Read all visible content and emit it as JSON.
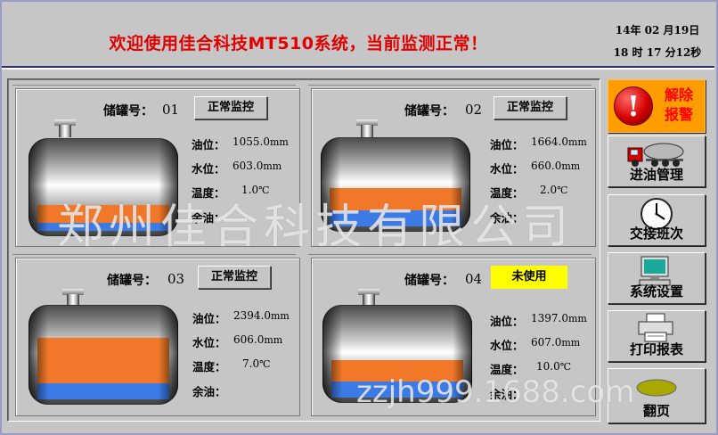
{
  "header": {
    "title": "欢迎使用佳合科技MT510系统，当前监测正常！",
    "date": "14年 02 月19日",
    "time": "18 时 17 分12秒"
  },
  "tank_number_label": "储罐号：",
  "tanks": [
    {
      "number": "01",
      "status": "正常监控",
      "status_color": "#c6c6c6",
      "oil_label": "油位：",
      "oil_value": "1055.0",
      "oil_unit": "mm",
      "water_label": "水位：",
      "water_value": "603.0",
      "water_unit": "mm",
      "temp_label": "温度：",
      "temp_value": "1.0",
      "temp_unit": "℃",
      "remain_label": "余油：",
      "remain_value": "",
      "oil_level_percent": 26,
      "water_level_percent": 8
    },
    {
      "number": "02",
      "status": "正常监控",
      "status_color": "#c6c6c6",
      "oil_label": "油位：",
      "oil_value": "1664.0",
      "oil_unit": "mm",
      "water_label": "水位：",
      "water_value": "660.0",
      "water_unit": "mm",
      "temp_label": "温度：",
      "temp_value": "2.0",
      "temp_unit": "℃",
      "remain_label": "余油：",
      "remain_value": "",
      "oil_level_percent": 41,
      "water_level_percent": 17
    },
    {
      "number": "03",
      "status": "正常监控",
      "status_color": "#c6c6c6",
      "oil_label": "油位：",
      "oil_value": "2394.0",
      "oil_unit": "mm",
      "water_label": "水位：",
      "water_value": "606.0",
      "water_unit": "mm",
      "temp_label": "温度：",
      "temp_value": "7.0",
      "temp_unit": "℃",
      "remain_label": "余油：",
      "remain_value": "",
      "oil_level_percent": 62,
      "water_level_percent": 16
    },
    {
      "number": "04",
      "status": "未使用",
      "status_color": "#ffff00",
      "oil_label": "油位：",
      "oil_value": "1397.0",
      "oil_unit": "mm",
      "water_label": "水位：",
      "water_value": "607.0",
      "water_unit": "mm",
      "temp_label": "温度：",
      "temp_value": "10.0",
      "temp_unit": "℃",
      "remain_label": "余油：",
      "remain_value": "",
      "oil_level_percent": 38,
      "water_level_percent": 16
    }
  ],
  "sidebar": {
    "alarm_line1": "解除",
    "alarm_line2": "报警",
    "alarm_symbol": "!",
    "oil_in": "进油管理",
    "shift": "交接班次",
    "settings": "系统设置",
    "print": "打印报表",
    "page": "翻页"
  },
  "watermark": {
    "company": "郑州佳合科技有限公司",
    "url": "zzjh999.1688.com"
  },
  "colors": {
    "oil": "#f07828",
    "water": "#3c7ae6",
    "title": "#e00000",
    "alarm_bg": "#ff9c00"
  }
}
